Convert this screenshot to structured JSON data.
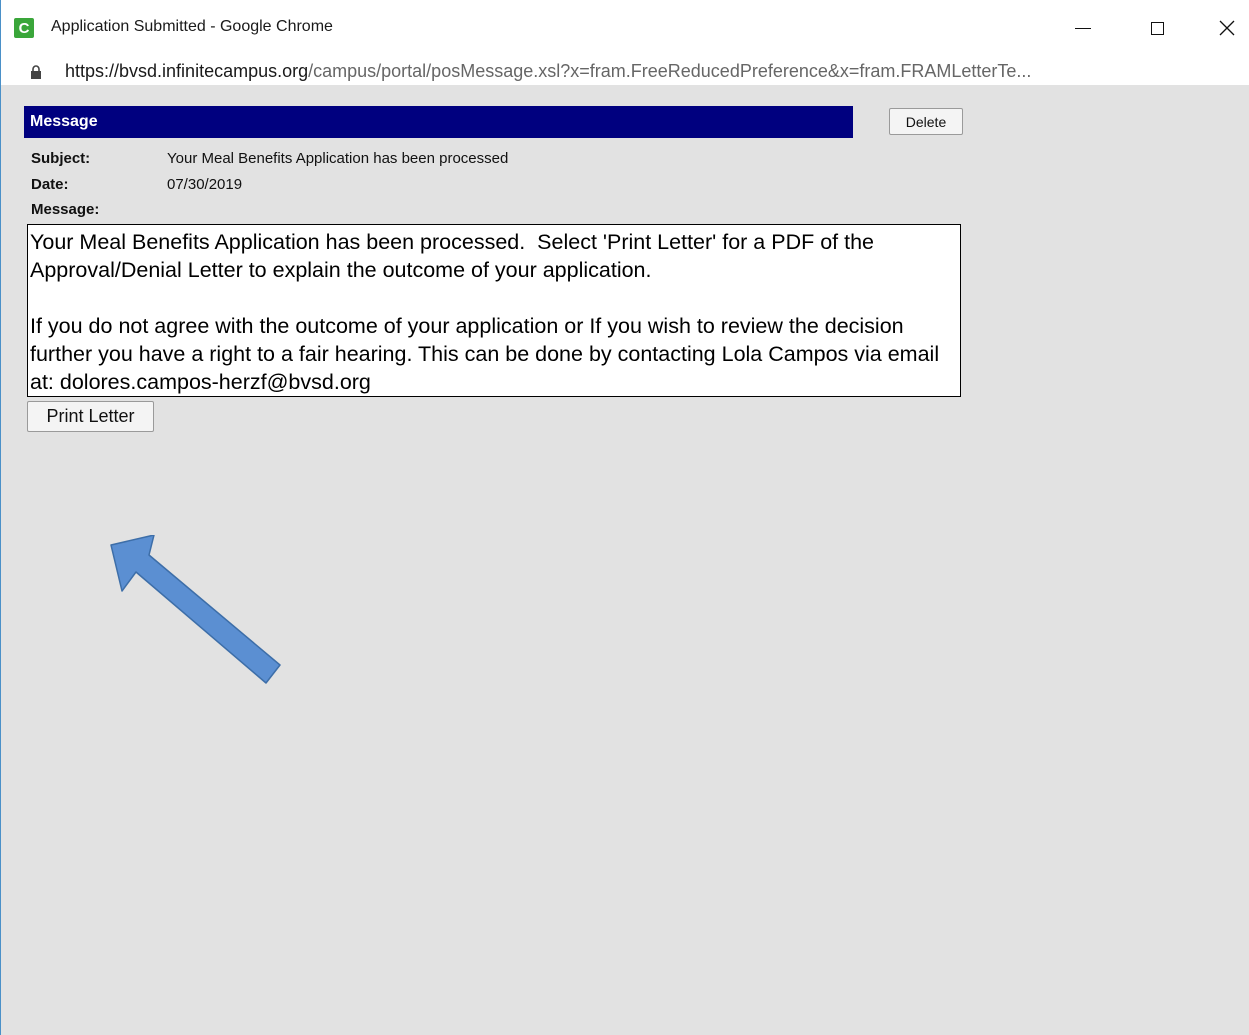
{
  "window": {
    "title": "Application Submitted - Google Chrome",
    "icon_letter": "C",
    "controls": [
      "minimize-icon",
      "maximize-icon",
      "close-icon"
    ]
  },
  "address": {
    "url_host": "https://bvsd.infinitecampus.org",
    "url_path": "/campus/portal/posMessage.xsl?x=fram.FreeReducedPreference&x=fram.FRAMLetterTe..."
  },
  "message": {
    "header": "Message",
    "delete_label": "Delete",
    "subject_label": "Subject:",
    "subject": "Your Meal Benefits Application has been processed",
    "date_label": "Date:",
    "date": "07/30/2019",
    "message_label": "Message:",
    "body_p1": "Your Meal Benefits Application has been processed.  Select 'Print Letter' for a PDF of the Approval/Denial Letter to explain the outcome of your application.",
    "body_p2": "If you do not agree with the outcome of your application or If you wish to review the decision further you have a right to a fair hearing. This can be done by contacting Lola Campos via email at: dolores.campos-herzf@bvsd.org",
    "print_label": "Print Letter"
  },
  "colors": {
    "header_bg": "#00007f",
    "page_bg": "#e2e2e2",
    "arrow": "#5b8fd2"
  }
}
